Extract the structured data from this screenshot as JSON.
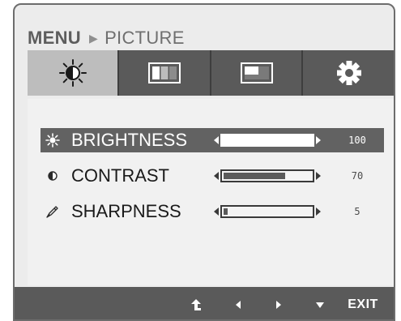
{
  "breadcrumb": {
    "menu": "MENU",
    "separator_icon": "right-triangle-icon",
    "section": "PICTURE"
  },
  "tabs": [
    {
      "icon": "brightness-contrast-icon",
      "selected": true
    },
    {
      "icon": "color-bars-icon",
      "selected": false
    },
    {
      "icon": "screen-position-icon",
      "selected": false
    },
    {
      "icon": "settings-gear-icon",
      "selected": false
    }
  ],
  "settings": [
    {
      "icon": "sun-icon",
      "label": "BRIGHTNESS",
      "value": "100",
      "level": 100,
      "selected": true
    },
    {
      "icon": "half-circle-contrast-icon",
      "label": "CONTRAST",
      "value": "70",
      "level": 70,
      "selected": false
    },
    {
      "icon": "sharpness-pen-icon",
      "label": "SHARPNESS",
      "value": "5",
      "level": 5,
      "selected": false
    }
  ],
  "nav": {
    "icons": [
      "up-arrow-icon",
      "left-arrow-icon",
      "right-arrow-icon",
      "down-arrow-icon"
    ],
    "exit_label": "EXIT"
  },
  "colors": {
    "frame": "#6d6d6d",
    "bar": "#5a5a5a",
    "selected_tab": "#bdbdbd",
    "panel": "#f1f1f1",
    "selected_row": "#626262"
  }
}
